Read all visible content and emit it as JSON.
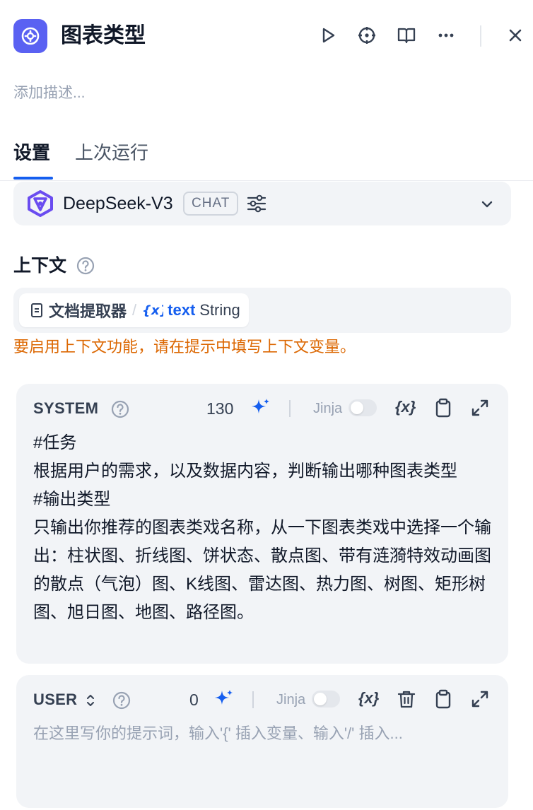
{
  "header": {
    "title": "图表类型",
    "description_placeholder": "添加描述..."
  },
  "tabs": [
    {
      "label": "设置",
      "active": true
    },
    {
      "label": "上次运行",
      "active": false
    }
  ],
  "model": {
    "name": "DeepSeek-V3",
    "mode_badge": "CHAT"
  },
  "context": {
    "label": "上下文",
    "source_node": "文档提取器",
    "variable_name": "text",
    "variable_type": "String",
    "warning": "要启用上下文功能，请在提示中填写上下文变量。"
  },
  "system_prompt": {
    "role": "SYSTEM",
    "char_count": "130",
    "jinja_label": "Jinja",
    "jinja_enabled": false,
    "text": "#任务\n根据用户的需求，以及数据内容，判断输出哪种图表类型\n#输出类型\n只输出你推荐的图表类戏名称，从一下图表类戏中选择一个输出：柱状图、折线图、饼状态、散点图、带有涟漪特效动画图的散点（气泡）图、K线图、雷达图、热力图、树图、矩形树图、旭日图、地图、路径图。"
  },
  "user_prompt": {
    "role": "USER",
    "char_count": "0",
    "jinja_label": "Jinja",
    "jinja_enabled": false,
    "placeholder": "在这里写你的提示词，输入'{' 插入变量、输入'/' 插入..."
  },
  "colors": {
    "accent": "#155eef",
    "node_icon_bg": "#5a61f2",
    "warning": "#dc6803",
    "card_bg": "#f2f4f7"
  }
}
